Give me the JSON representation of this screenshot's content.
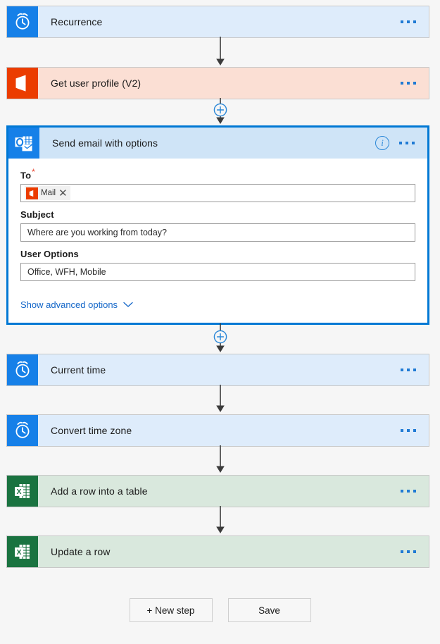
{
  "theme": {
    "canvas_bg": "#f6f6f6",
    "accent": "#0078d4",
    "tone_blue": "#deecfb",
    "tone_peach": "#fbdfd4",
    "tone_green": "#d9e8dd",
    "link_color": "#1366c8",
    "required_star_color": "#e8422e"
  },
  "steps": [
    {
      "id": "recurrence",
      "title": "Recurrence",
      "icon": "alarm-clock-icon",
      "tone": "blue",
      "selected": false,
      "more_label": "More commands"
    },
    {
      "id": "get-user-profile",
      "title": "Get user profile (V2)",
      "icon": "office365-icon",
      "tone": "peach",
      "selected": false,
      "more_label": "More commands"
    },
    {
      "id": "send-email-with-options",
      "title": "Send email with options",
      "icon": "outlook-icon",
      "tone": "blue",
      "selected": true,
      "info_label": "i",
      "more_label": "More commands",
      "fields": {
        "to": {
          "label": "To",
          "required_marker": "*",
          "token": {
            "label": "Mail",
            "icon": "office365-icon",
            "remove_label": "✕"
          }
        },
        "subject": {
          "label": "Subject",
          "value": "Where are you working from today?"
        },
        "user_options": {
          "label": "User Options",
          "value": "Office, WFH, Mobile"
        }
      },
      "advanced": {
        "label": "Show advanced options",
        "icon": "chevron-down-icon"
      }
    },
    {
      "id": "current-time",
      "title": "Current time",
      "icon": "alarm-clock-icon",
      "tone": "blue",
      "selected": false,
      "more_label": "More commands"
    },
    {
      "id": "convert-time-zone",
      "title": "Convert time zone",
      "icon": "alarm-clock-icon",
      "tone": "blue",
      "selected": false,
      "more_label": "More commands"
    },
    {
      "id": "add-a-row-into-a-table",
      "title": "Add a row into a table",
      "icon": "excel-icon",
      "tone": "green",
      "selected": false,
      "more_label": "More commands"
    },
    {
      "id": "update-a-row",
      "title": "Update a row",
      "icon": "excel-icon",
      "tone": "green",
      "selected": false,
      "more_label": "More commands"
    }
  ],
  "connectors": [
    {
      "id": "c1",
      "has_plus": false
    },
    {
      "id": "c2",
      "has_plus": true,
      "add_label": "+"
    },
    {
      "id": "c3",
      "has_plus": true,
      "add_label": "+"
    },
    {
      "id": "c4",
      "has_plus": false
    },
    {
      "id": "c5",
      "has_plus": false
    },
    {
      "id": "c6",
      "has_plus": false
    }
  ],
  "footer": {
    "new_step_label": "+ New step",
    "save_label": "Save"
  }
}
